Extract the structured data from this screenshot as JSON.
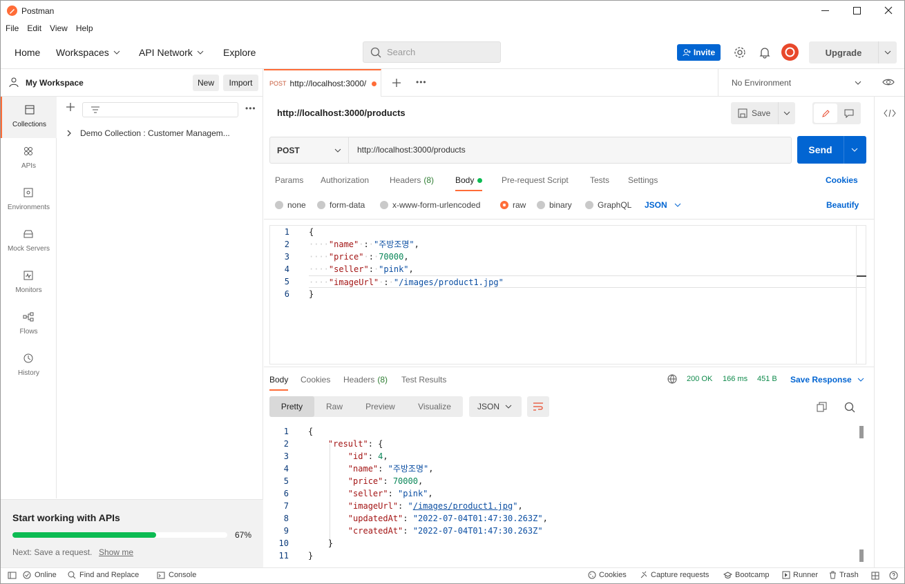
{
  "titlebar": {
    "title": "Postman"
  },
  "menubar": [
    "File",
    "Edit",
    "View",
    "Help"
  ],
  "header": {
    "home": "Home",
    "workspaces": "Workspaces",
    "api_network": "API Network",
    "explore": "Explore",
    "search_placeholder": "Search",
    "invite": "Invite",
    "upgrade": "Upgrade"
  },
  "sidebar": {
    "workspace": "My Workspace",
    "new": "New",
    "import": "Import",
    "rail": [
      "Collections",
      "APIs",
      "Environments",
      "Mock Servers",
      "Monitors",
      "Flows",
      "History"
    ],
    "collection": "Demo Collection : Customer Managem...",
    "onboarding": {
      "title": "Start working with APIs",
      "progress": 0.67,
      "progress_label": "67%",
      "next": "Next: Save a request.",
      "show_me": "Show me"
    }
  },
  "tabs": {
    "active": {
      "method": "POST",
      "label": "http://localhost:3000/"
    }
  },
  "env": {
    "selected": "No Environment"
  },
  "request": {
    "title": "http://localhost:3000/products",
    "save": "Save",
    "method": "POST",
    "url": "http://localhost:3000/products",
    "send": "Send",
    "subtabs": [
      "Params",
      "Authorization",
      "Headers",
      "(8)",
      "Body",
      "Pre-request Script",
      "Tests",
      "Settings"
    ],
    "cookies": "Cookies",
    "body_types": [
      "none",
      "form-data",
      "x-www-form-urlencoded",
      "raw",
      "binary",
      "GraphQL"
    ],
    "body_lang": "JSON",
    "beautify": "Beautify",
    "body_lines": [
      "1",
      "2",
      "3",
      "4",
      "5",
      "6"
    ]
  },
  "response": {
    "tabs": [
      "Body",
      "Cookies",
      "Headers",
      "(8)",
      "Test Results"
    ],
    "status": "200 OK",
    "time": "166 ms",
    "size": "451 B",
    "save": "Save Response",
    "views": [
      "Pretty",
      "Raw",
      "Preview",
      "Visualize"
    ],
    "lang": "JSON",
    "lines": [
      "1",
      "2",
      "3",
      "4",
      "5",
      "6",
      "7",
      "8",
      "9",
      "10",
      "11"
    ]
  },
  "statusbar": {
    "online": "Online",
    "find": "Find and Replace",
    "console": "Console",
    "cookies": "Cookies",
    "capture": "Capture requests",
    "bootcamp": "Bootcamp",
    "runner": "Runner",
    "trash": "Trash"
  },
  "colors": {
    "accent": "#ff6c37",
    "send": "#0265d2",
    "ok": "#0f8a4b"
  }
}
